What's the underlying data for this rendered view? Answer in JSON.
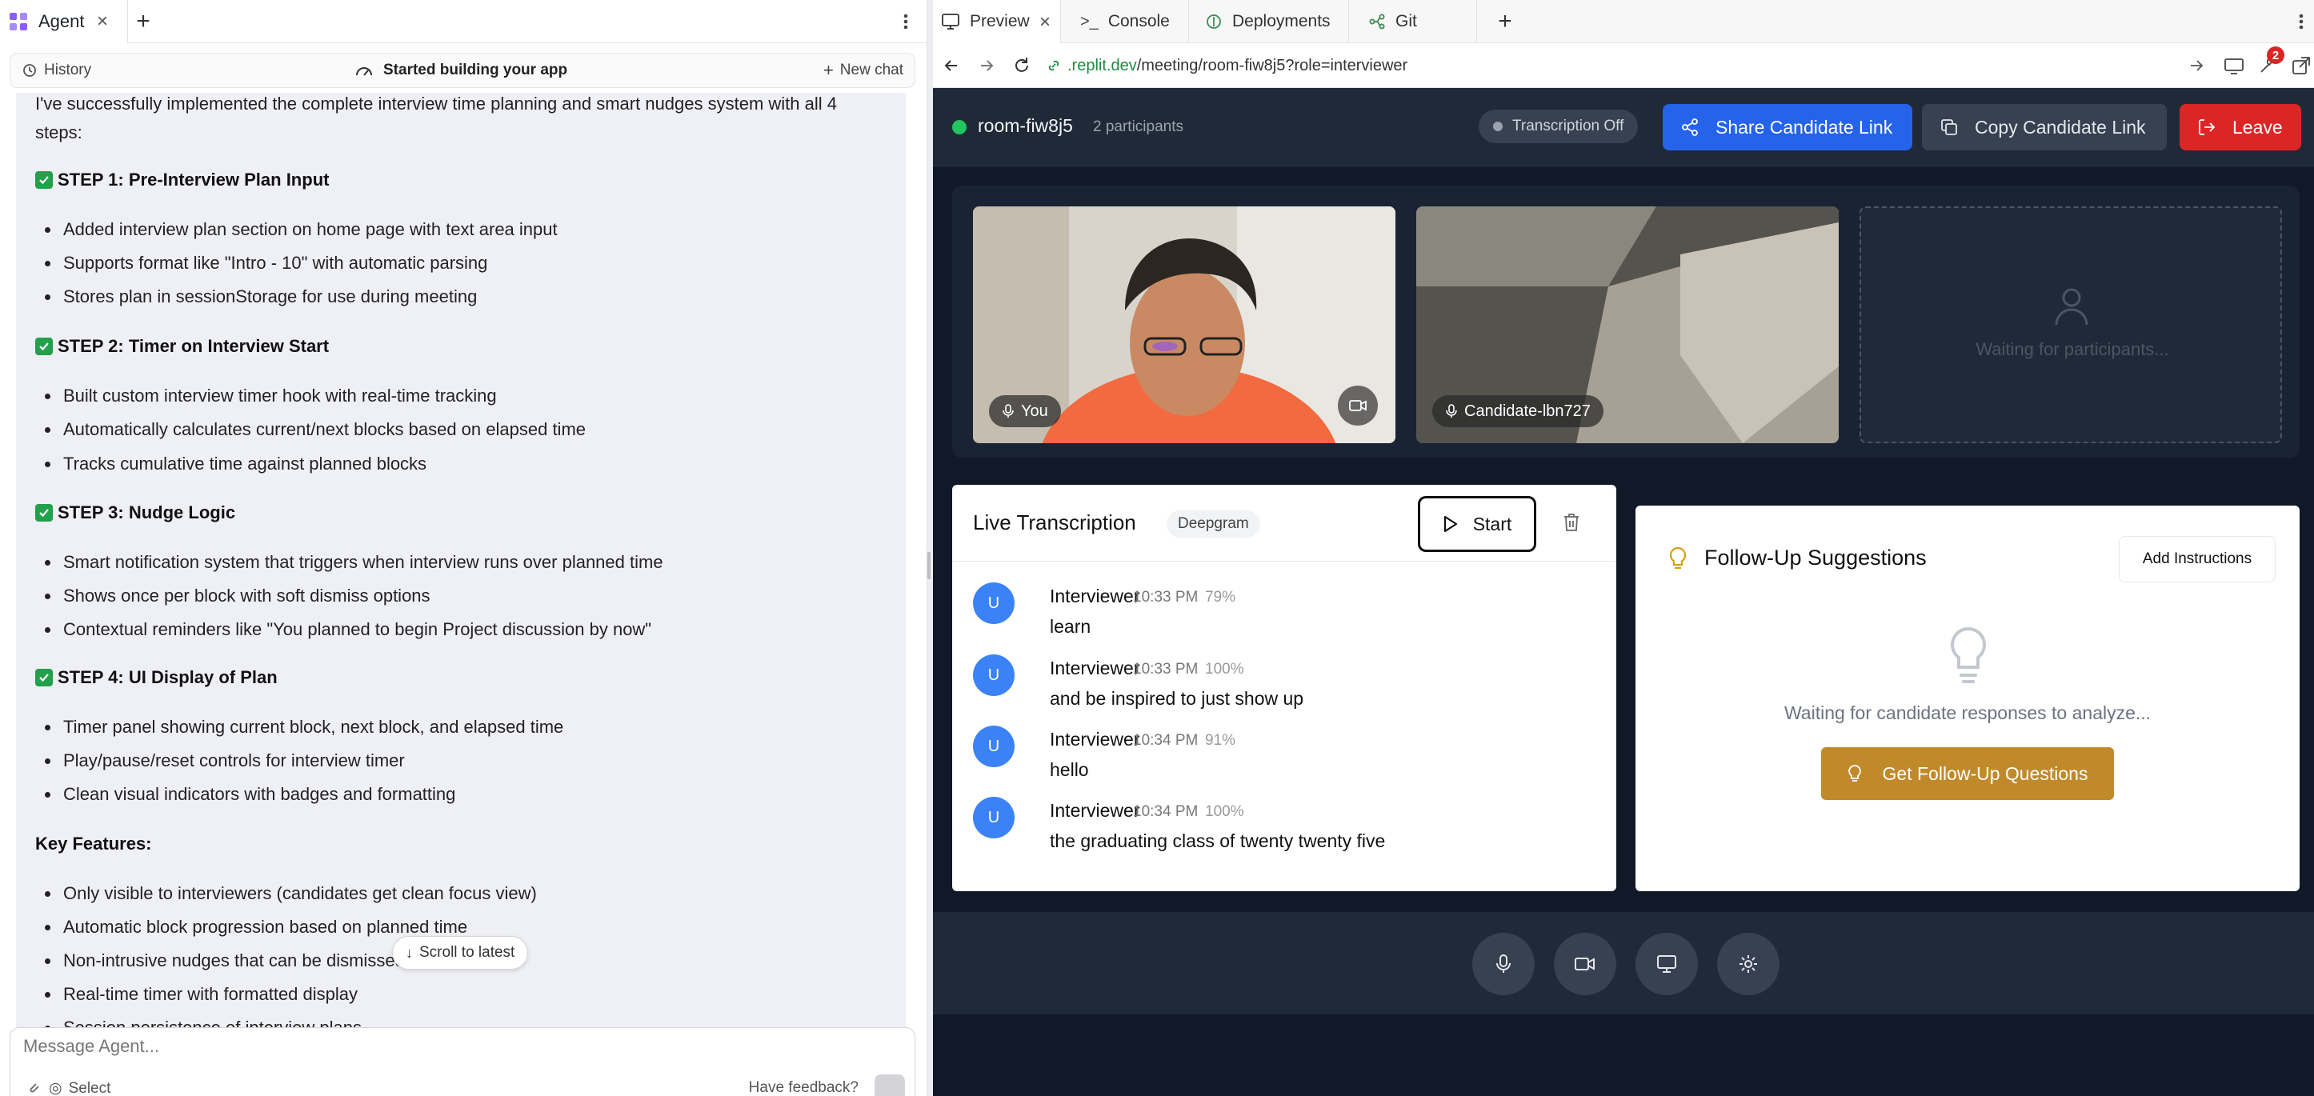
{
  "left": {
    "tab_label": "Agent",
    "subbar": {
      "history": "History",
      "status": "Started building your app",
      "new_chat": "New chat"
    },
    "chat": {
      "intro": "I've successfully implemented the complete interview time planning and smart nudges system with all 4 steps:",
      "steps": [
        {
          "title": "STEP 1: Pre-Interview Plan Input",
          "bullets": [
            "Added interview plan section on home page with text area input",
            "Supports format like \"Intro - 10\" with automatic parsing",
            "Stores plan in sessionStorage for use during meeting"
          ]
        },
        {
          "title": "STEP 2: Timer on Interview Start",
          "bullets": [
            "Built custom interview timer hook with real-time tracking",
            "Automatically calculates current/next blocks based on elapsed time",
            "Tracks cumulative time against planned blocks"
          ]
        },
        {
          "title": "STEP 3: Nudge Logic",
          "bullets": [
            "Smart notification system that triggers when interview runs over planned time",
            "Shows once per block with soft dismiss options",
            "Contextual reminders like \"You planned to begin Project discussion by now\""
          ]
        },
        {
          "title": "STEP 4: UI Display of Plan",
          "bullets": [
            "Timer panel showing current block, next block, and elapsed time",
            "Play/pause/reset controls for interview timer",
            "Clean visual indicators with badges and formatting"
          ]
        }
      ],
      "key_features_title": "Key Features:",
      "key_features": [
        "Only visible to interviewers (candidates get clean focus view)",
        "Automatic block progression based on planned time",
        "Non-intrusive nudges that can be dismissed",
        "Real-time timer with formatted display",
        "Session persistence of interview plans"
      ],
      "scroll_latest": "Scroll to latest"
    },
    "composer": {
      "placeholder": "Message Agent...",
      "select": "Select",
      "feedback": "Have feedback?"
    }
  },
  "right": {
    "tabs": [
      "Preview",
      "Console",
      "Deployments",
      "Git"
    ],
    "url": {
      "host": ".replit.dev",
      "path": "/meeting/room-fiw8j5?role=interviewer"
    },
    "tools_badge": "2",
    "app": {
      "room_name": "room-fiw8j5",
      "participants": "2 participants",
      "transcription_status": "Transcription Off",
      "share_label": "Share Candidate Link",
      "copy_label": "Copy Candidate Link",
      "leave_label": "Leave",
      "tiles": {
        "you": "You",
        "candidate": "Candidate-lbn727",
        "waiting": "Waiting for participants..."
      },
      "live": {
        "title": "Live Transcription",
        "provider": "Deepgram",
        "start": "Start",
        "entries": [
          {
            "avatar": "U",
            "speaker": "Interviewer",
            "time": "10:33 PM",
            "confidence": "79%",
            "text": "learn"
          },
          {
            "avatar": "U",
            "speaker": "Interviewer",
            "time": "10:33 PM",
            "confidence": "100%",
            "text": "and be inspired to just show up"
          },
          {
            "avatar": "U",
            "speaker": "Interviewer",
            "time": "10:34 PM",
            "confidence": "91%",
            "text": "hello"
          },
          {
            "avatar": "U",
            "speaker": "Interviewer",
            "time": "10:34 PM",
            "confidence": "100%",
            "text": "the graduating class of twenty twenty five"
          }
        ]
      },
      "followup": {
        "title": "Follow-Up Suggestions",
        "add_instructions": "Add Instructions",
        "waiting": "Waiting for candidate responses to analyze...",
        "get_button": "Get Follow-Up Questions"
      }
    }
  },
  "colors": {
    "app_bg": "#111827",
    "share": "#2563eb",
    "leave": "#dc2626",
    "followup_button": "#c08a2b",
    "avatar": "#3b82f6",
    "status_green": "#22c55e"
  }
}
